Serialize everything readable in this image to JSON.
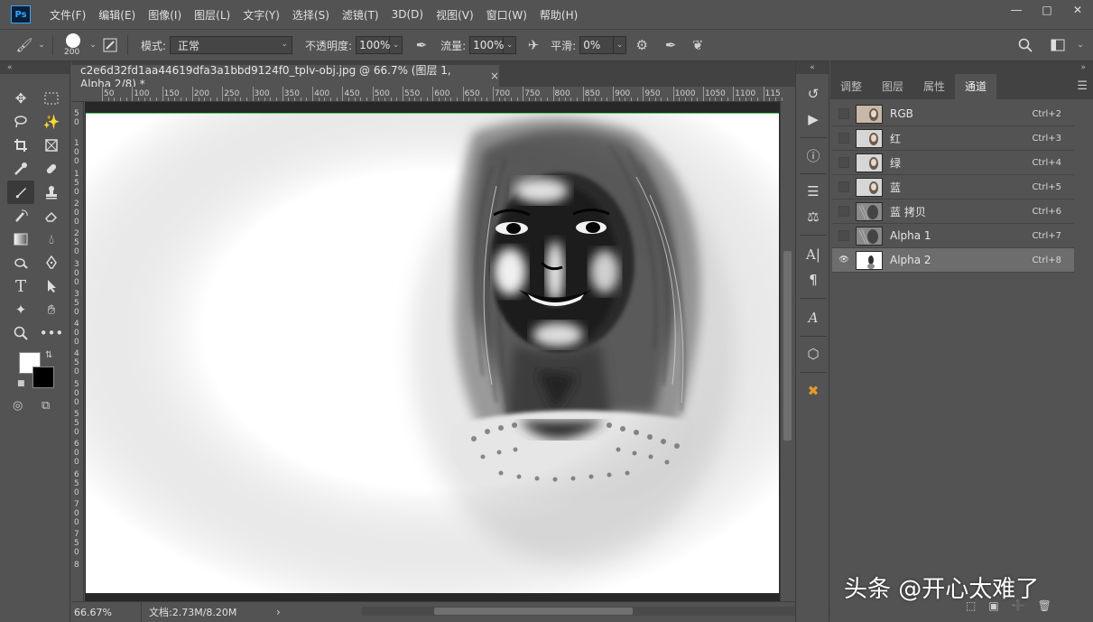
{
  "menubar": {
    "logo": "Ps",
    "items": [
      "文件(F)",
      "编辑(E)",
      "图像(I)",
      "图层(L)",
      "文字(Y)",
      "选择(S)",
      "滤镜(T)",
      "3D(D)",
      "视图(V)",
      "窗口(W)",
      "帮助(H)"
    ]
  },
  "options": {
    "brush_size": "200",
    "mode_label": "模式:",
    "mode_value": "正常",
    "opacity_label": "不透明度:",
    "opacity_value": "100%",
    "flow_label": "流量:",
    "flow_value": "100%",
    "smoothing_label": "平滑:",
    "smoothing_value": "0%"
  },
  "document": {
    "tab_title": "c2e6d32fd1aa44619dfa3a1bbd9124f0_tplv-obj.jpg @ 66.7% (图层 1, Alpha 2/8) *",
    "close": "×",
    "zoom": "66.67%",
    "doc_info": "文档:2.73M/8.20M",
    "status_arrow": "›"
  },
  "ruler": {
    "top_labels": [
      "50",
      "100",
      "150",
      "200",
      "250",
      "300",
      "350",
      "400",
      "450",
      "500",
      "550",
      "600",
      "650",
      "700",
      "750",
      "800",
      "850",
      "900",
      "950",
      "1000",
      "1050",
      "1100",
      "115"
    ],
    "left_labels": [
      "5\n0",
      "1\n0\n0",
      "1\n5\n0",
      "2\n0\n0",
      "2\n5\n0",
      "3\n0\n0",
      "3\n5\n0",
      "4\n0\n0",
      "4\n5\n0",
      "5\n0\n0",
      "5\n5\n0",
      "6\n0\n0",
      "6\n5\n0",
      "7\n0\n0",
      "7\n5\n0",
      "8"
    ]
  },
  "panel": {
    "tabs": [
      "调整",
      "图层",
      "属性",
      "通道"
    ],
    "active_tab": "通道",
    "channels": [
      {
        "name": "RGB",
        "shortcut": "Ctrl+2",
        "visible": false,
        "selected": false
      },
      {
        "name": "红",
        "shortcut": "Ctrl+3",
        "visible": false,
        "selected": false
      },
      {
        "name": "绿",
        "shortcut": "Ctrl+4",
        "visible": false,
        "selected": false
      },
      {
        "name": "蓝",
        "shortcut": "Ctrl+5",
        "visible": false,
        "selected": false
      },
      {
        "name": "蓝 拷贝",
        "shortcut": "Ctrl+6",
        "visible": false,
        "selected": false
      },
      {
        "name": "Alpha 1",
        "shortcut": "Ctrl+7",
        "visible": false,
        "selected": false
      },
      {
        "name": "Alpha 2",
        "shortcut": "Ctrl+8",
        "visible": true,
        "selected": true
      }
    ]
  },
  "watermark": "头条 @开心太难了",
  "colors": {
    "ui_bg": "#535353",
    "dark_bg": "#424242",
    "accent": "#31a8ff",
    "foreground": "#ffffff",
    "background": "#000000"
  }
}
